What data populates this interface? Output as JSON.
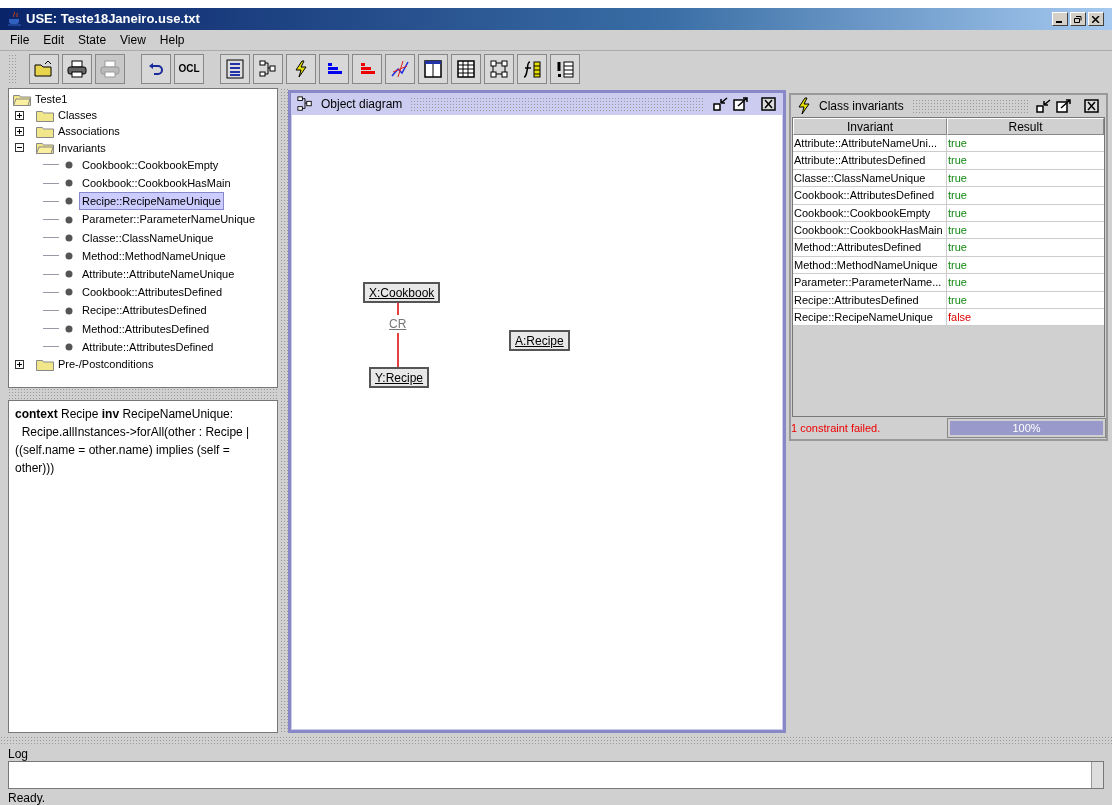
{
  "window": {
    "title": "USE: Teste18Janeiro.use.txt"
  },
  "menu": [
    "File",
    "Edit",
    "State",
    "View",
    "Help"
  ],
  "toolbar": [
    {
      "kind": "open",
      "disabled": false
    },
    {
      "kind": "print",
      "disabled": false
    },
    {
      "kind": "print",
      "disabled": true
    },
    {
      "kind": "sep"
    },
    {
      "kind": "undo",
      "disabled": false
    },
    {
      "kind": "text",
      "label": "OCL",
      "disabled": false
    },
    {
      "kind": "sep"
    },
    {
      "kind": "classview",
      "disabled": false
    },
    {
      "kind": "objdiagram",
      "disabled": false
    },
    {
      "kind": "bolt",
      "disabled": false
    },
    {
      "kind": "bars",
      "color": "#0000ee",
      "disabled": false
    },
    {
      "kind": "bars",
      "color": "#ee0000",
      "disabled": false
    },
    {
      "kind": "chart",
      "disabled": false
    },
    {
      "kind": "panel",
      "disabled": false
    },
    {
      "kind": "table",
      "disabled": false
    },
    {
      "kind": "nodes",
      "disabled": false
    },
    {
      "kind": "func",
      "disabled": false
    },
    {
      "kind": "excl",
      "disabled": false
    }
  ],
  "tree": {
    "label": "Teste1",
    "expanded": true,
    "children": [
      {
        "label": "Classes",
        "expanded": false
      },
      {
        "label": "Associations",
        "expanded": false
      },
      {
        "label": "Invariants",
        "expanded": true,
        "children": [
          {
            "label": "Cookbook::CookbookEmpty",
            "selected": false
          },
          {
            "label": "Cookbook::CookbookHasMain",
            "selected": false
          },
          {
            "label": "Recipe::RecipeNameUnique",
            "selected": true
          },
          {
            "label": "Parameter::ParameterNameUnique",
            "selected": false
          },
          {
            "label": "Classe::ClassNameUnique",
            "selected": false
          },
          {
            "label": "Method::MethodNameUnique",
            "selected": false
          },
          {
            "label": "Attribute::AttributeNameUnique",
            "selected": false
          },
          {
            "label": "Cookbook::AttributesDefined",
            "selected": false
          },
          {
            "label": "Recipe::AttributesDefined",
            "selected": false
          },
          {
            "label": "Method::AttributesDefined",
            "selected": false
          },
          {
            "label": "Attribute::AttributesDefined",
            "selected": false
          }
        ]
      },
      {
        "label": "Pre-/Postconditions",
        "expanded": false
      }
    ]
  },
  "ocl_text": "**context** Recipe **inv** RecipeNameUnique:\n  Recipe.allInstances->forAll(other : Recipe | ((self.name = other.name) implies (self = other)))",
  "object_diagram": {
    "title": "Object diagram",
    "objects": [
      {
        "label": "X:Cookbook"
      },
      {
        "label": "Y:Recipe"
      },
      {
        "label": "A:Recipe"
      }
    ],
    "links": [
      {
        "label": "CR"
      }
    ]
  },
  "class_invariants": {
    "title": "Class invariants",
    "columns": [
      "Invariant",
      "Result"
    ],
    "rows": [
      {
        "invariant": "Attribute::AttributeNameUni...",
        "result": "true",
        "passed": true
      },
      {
        "invariant": "Attribute::AttributesDefined",
        "result": "true",
        "passed": true
      },
      {
        "invariant": "Classe::ClassNameUnique",
        "result": "true",
        "passed": true
      },
      {
        "invariant": "Cookbook::AttributesDefined",
        "result": "true",
        "passed": true
      },
      {
        "invariant": "Cookbook::CookbookEmpty",
        "result": "true",
        "passed": true
      },
      {
        "invariant": "Cookbook::CookbookHasMain",
        "result": "true",
        "passed": true
      },
      {
        "invariant": "Method::AttributesDefined",
        "result": "true",
        "passed": true
      },
      {
        "invariant": "Method::MethodNameUnique",
        "result": "true",
        "passed": true
      },
      {
        "invariant": "Parameter::ParameterName...",
        "result": "true",
        "passed": true
      },
      {
        "invariant": "Recipe::AttributesDefined",
        "result": "true",
        "passed": true
      },
      {
        "invariant": "Recipe::RecipeNameUnique",
        "result": "false",
        "passed": false
      }
    ],
    "status": "1 constraint failed.",
    "progress": {
      "level": 1,
      "reading": "100%"
    }
  },
  "log": {
    "title": "Log"
  },
  "status_bar": "Ready."
}
